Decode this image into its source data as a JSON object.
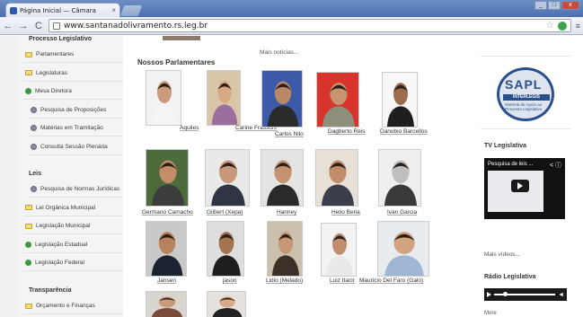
{
  "browser": {
    "tab_title": "Página Inicial — Câmara",
    "tab_close": "×",
    "url": "www.santanadolivramento.rs.leg.br",
    "win_minimize": "_",
    "win_maximize": "□",
    "win_close": "x"
  },
  "sidebar": {
    "heading_processo": "Processo Legislativo",
    "processo_items": [
      {
        "label": "Parlamentares",
        "icon": "folder-icon"
      },
      {
        "label": "Legislaturas",
        "icon": "folder-icon"
      },
      {
        "label": "Mesa Diretora",
        "icon": "plus-icon"
      },
      {
        "label": "Pesquisa de Proposições",
        "icon": "gear-icon"
      },
      {
        "label": "Matérias em Tramitação",
        "icon": "gear-icon"
      },
      {
        "label": "Consulta Sessão Plenária",
        "icon": "gear-icon"
      }
    ],
    "heading_leis": "Leis",
    "leis_items": [
      {
        "label": "Pesquisa de Normas Jurídicas",
        "icon": "gear-icon"
      },
      {
        "label": "Lei Orgânica Municipal",
        "icon": "folder-icon"
      },
      {
        "label": "Legislação Municipal",
        "icon": "folder-icon"
      },
      {
        "label": "Legislação Estadual",
        "icon": "plus-icon"
      },
      {
        "label": "Legislação Federal",
        "icon": "plus-icon"
      }
    ],
    "heading_transparencia": "Transparência",
    "transparencia_items": [
      {
        "label": "Orçamento e Finanças",
        "icon": "folder-icon"
      }
    ]
  },
  "main": {
    "more_news": "Mais notícias...",
    "section_title": "Nossos Parlamentares",
    "parlamentares": [
      {
        "name": "Aquiles",
        "bg": "#f2f2f2",
        "skin": "#c99a7c",
        "shirt": "#f5f5f5"
      },
      {
        "name": "Carine Frassoni",
        "bg": "#d9c6a8",
        "skin": "#d7a884",
        "shirt": "#9a6f9e"
      },
      {
        "name": "Carlos Nilo",
        "bg": "#3d5aa8",
        "skin": "#b98868",
        "shirt": "#2b2b2b"
      },
      {
        "name": "Dagberto Reis",
        "bg": "#d8342b",
        "skin": "#c6956f",
        "shirt": "#8d8f7a"
      },
      {
        "name": "Danubio Barcellos",
        "bg": "#f7f7f7",
        "skin": "#9b6d4f",
        "shirt": "#1f1f1f"
      },
      {
        "name": "Germano Camacho",
        "bg": "#4d6b3a",
        "skin": "#c48d6a",
        "shirt": "#3c3c3c"
      },
      {
        "name": "Gilbert (Xepa)",
        "bg": "#e9e9e9",
        "skin": "#c9987a",
        "shirt": "#2f3542"
      },
      {
        "name": "Hanney",
        "bg": "#e4e4e4",
        "skin": "#c5936f",
        "shirt": "#2a2a2a"
      },
      {
        "name": "Helio Beria",
        "bg": "#e6e0d6",
        "skin": "#c08c6a",
        "shirt": "#3a3e4a"
      },
      {
        "name": "Ivan Garcia",
        "bg": "#efefef",
        "skin": "#bfbfbf",
        "shirt": "#3a3a3a"
      },
      {
        "name": "Jansen",
        "bg": "#c9c9c9",
        "skin": "#b7835f",
        "shirt": "#1d2230"
      },
      {
        "name": "jason",
        "bg": "#dedede",
        "skin": "#a47352",
        "shirt": "#1e1e1e"
      },
      {
        "name": "Lidio (Melado)",
        "bg": "#cbbfae",
        "skin": "#c69876",
        "shirt": "#3b3128"
      },
      {
        "name": "Luiz Itacir",
        "bg": "#f3f3f3",
        "skin": "#c08e6c",
        "shirt": "#e9e9e9"
      },
      {
        "name": "Mauricio Del Faro (Galo)",
        "bg": "#e8ecef",
        "skin": "#d2a381",
        "shirt": "#9fb6d4"
      },
      {
        "name": "",
        "bg": "#d9d5cf",
        "skin": "#c99b79",
        "shirt": "#7a4a3a"
      },
      {
        "name": "",
        "bg": "#e5e2de",
        "skin": "#d6a988",
        "shirt": "#222222"
      }
    ]
  },
  "right": {
    "sapl_title": "SAPL",
    "sapl_band": "INTERLEGIS",
    "sapl_sub": "Sistema de Apoio ao Processo Legislativo",
    "tv_heading": "TV Legislativa",
    "tv_video_title": "Pesquisa de leis ...",
    "more_videos": "Mais vídeos...",
    "radio_heading": "Rádio Legislativa",
    "more_radio": "More"
  }
}
